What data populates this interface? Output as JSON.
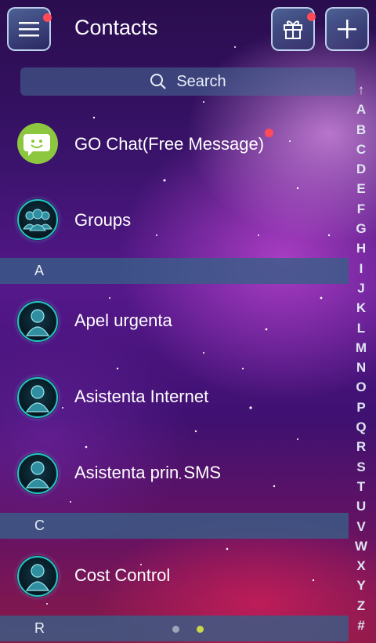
{
  "header": {
    "title": "Contacts"
  },
  "search": {
    "label": "Search"
  },
  "special_items": [
    {
      "label": "GO Chat(Free Message)"
    },
    {
      "label": "Groups"
    }
  ],
  "sections": [
    {
      "letter": "A",
      "contacts": [
        "Apel urgenta",
        "Asistenta Internet",
        "Asistenta prin SMS"
      ]
    },
    {
      "letter": "C",
      "contacts": [
        "Cost Control"
      ]
    },
    {
      "letter": "R",
      "contacts": []
    }
  ],
  "alpha_index": [
    "↑",
    "A",
    "B",
    "C",
    "D",
    "E",
    "F",
    "G",
    "H",
    "I",
    "J",
    "K",
    "L",
    "M",
    "N",
    "O",
    "P",
    "Q",
    "R",
    "S",
    "T",
    "U",
    "V",
    "W",
    "X",
    "Y",
    "Z",
    "#"
  ],
  "colors": {
    "notification": "#ff4b58",
    "teal_ring": "#21c6c4",
    "chat_green": "#8dc63f",
    "section_bar": "#375f87"
  },
  "icons": {
    "menu": "hamburger-icon",
    "gift": "gift-icon",
    "add": "plus-icon",
    "search": "search-icon",
    "chat": "chat-bubble-icon",
    "groups": "group-icon",
    "contact": "person-icon"
  },
  "pager": {
    "pages": 2,
    "active": 2
  }
}
